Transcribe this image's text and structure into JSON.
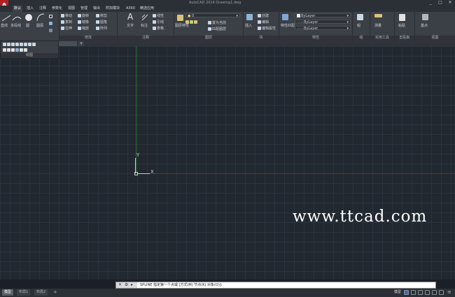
{
  "window": {
    "title": "AutoCAD 2014  Drawing1.dwg",
    "min": "_",
    "max": "□",
    "close": "✕"
  },
  "app_logo": "A",
  "menu": [
    "默认",
    "插入",
    "注释",
    "参数化",
    "视图",
    "管理",
    "输出",
    "附加模块",
    "A360",
    "精选应用"
  ],
  "ribbon": {
    "draw": {
      "title": "绘图",
      "line": "直线",
      "polyline": "多段线",
      "circle": "圆",
      "arc": "圆弧"
    },
    "modify": {
      "title": "修改",
      "move": "移动",
      "rotate": "旋转",
      "trim": "修剪",
      "copy": "复制",
      "mirror": "镜像",
      "fillet": "圆角",
      "stretch": "拉伸",
      "scale": "缩放",
      "array": "阵列"
    },
    "annotation": {
      "title": "注释",
      "text": "文字",
      "dimension": "标注",
      "linear": "线性",
      "leader": "引线",
      "table": "表格"
    },
    "layers": {
      "title": "图层",
      "properties": "图层特性",
      "current_layer": "0",
      "make_current": "置为当前",
      "match": "匹配图层"
    },
    "block": {
      "title": "块",
      "insert": "插入",
      "create": "创建",
      "edit": "编辑",
      "attribute": "编辑属性"
    },
    "properties": {
      "title": "特性",
      "match": "特性匹配",
      "color": "ByLayer",
      "linetype": "ByLayer",
      "lineweight": "ByLayer"
    },
    "groups": {
      "title": "组",
      "group": "组"
    },
    "utilities": {
      "title": "实用工具",
      "measure": "测量"
    },
    "clipboard": {
      "title": "剪贴板",
      "paste": "粘贴"
    },
    "view": {
      "title": "视图",
      "base": "基点"
    }
  },
  "float_panel": {
    "title": "绘图"
  },
  "ucs": {
    "x": "X",
    "y": "Y"
  },
  "watermark": "www.ttcad.com",
  "command": {
    "text": "SPLINE 指定第一个点或 [方式(M) 节点(K) 对象(O)]:"
  },
  "layout_tabs": [
    "模型",
    "布局1",
    "布局2"
  ],
  "status": {
    "model": "模型"
  }
}
